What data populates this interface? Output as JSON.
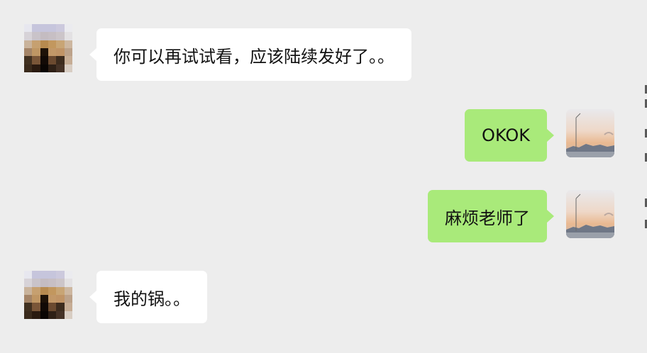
{
  "colors": {
    "background": "#ededed",
    "incoming_bubble": "#ffffff",
    "outgoing_bubble": "#a9ea7a",
    "text": "#111111"
  },
  "messages": [
    {
      "direction": "incoming",
      "text": "你可以再试试看，应该陆续发好了。。",
      "avatar": "pixelated-avatar-icon"
    },
    {
      "direction": "outgoing",
      "text": "OKOK",
      "avatar": "sunset-avatar-icon"
    },
    {
      "direction": "outgoing",
      "text": "麻烦老师了",
      "avatar": "sunset-avatar-icon"
    },
    {
      "direction": "incoming",
      "text": "我的锅。。",
      "avatar": "pixelated-avatar-icon"
    }
  ]
}
